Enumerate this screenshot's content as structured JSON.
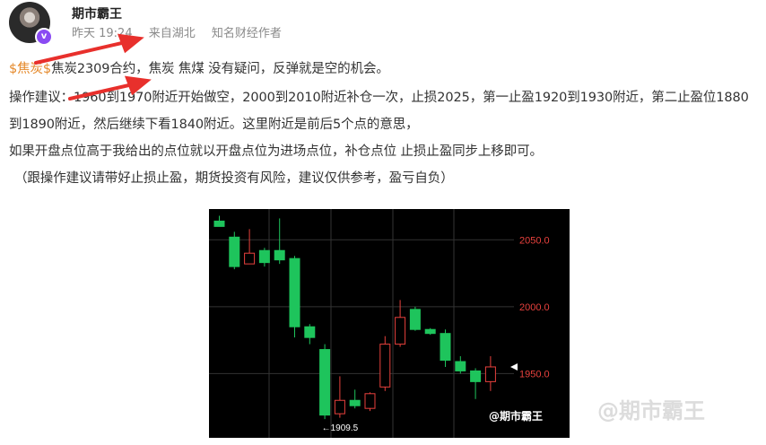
{
  "post": {
    "username": "期市霸王",
    "time": "昨天 19:24",
    "location": "来自湖北",
    "badge": "知名财经作者",
    "stock_tag": "$焦炭$",
    "line1_rest": "焦炭2309合约，焦炭 焦煤 没有疑问，反弹就是空的机会。",
    "line2": "操作建议：1960到1970附近开始做空，2000到2010附近补仓一次，止损2025，第一止盈1920到1930附近，第二止盈位1880",
    "line3": "到1890附近，然后继续下看1840附近。这里附近是前后5个点的意思，",
    "line4": "如果开盘点位高于我给出的点位就以开盘点位为进场点位，补仓点位 止损止盈同步上移即可。",
    "line5": "（跟操作建议请带好止损止盈，期货投资有风险，建议仅供参考，盈亏自负）",
    "watermark": "@期市霸王"
  },
  "chart_data": {
    "type": "candlestick",
    "price_labels": [
      "2050.0",
      "2000.0",
      "1950.0"
    ],
    "low_label": "←1909.5",
    "watermark": "@期市霸王",
    "ylim": [
      1902,
      2073
    ],
    "candles": [
      {
        "o": 2064,
        "c": 2060,
        "h": 2068,
        "l": 2060
      },
      {
        "o": 2052,
        "c": 2030,
        "h": 2056,
        "l": 2028
      },
      {
        "o": 2032,
        "c": 2040,
        "h": 2058,
        "l": 2032
      },
      {
        "o": 2042,
        "c": 2033,
        "h": 2044,
        "l": 2030
      },
      {
        "o": 2042,
        "c": 2035,
        "h": 2066,
        "l": 2032
      },
      {
        "o": 2036,
        "c": 1985,
        "h": 2038,
        "l": 1977
      },
      {
        "o": 1985,
        "c": 1977,
        "h": 1987,
        "l": 1972
      },
      {
        "o": 1968,
        "c": 1919,
        "h": 1972,
        "l": 1916
      },
      {
        "o": 1920,
        "c": 1930,
        "h": 1948,
        "l": 1917
      },
      {
        "o": 1930,
        "c": 1926,
        "h": 1938,
        "l": 1924
      },
      {
        "o": 1924,
        "c": 1935,
        "h": 1936,
        "l": 1922
      },
      {
        "o": 1940,
        "c": 1972,
        "h": 1978,
        "l": 1937
      },
      {
        "o": 1972,
        "c": 1992,
        "h": 2005,
        "l": 1970
      },
      {
        "o": 1998,
        "c": 1983,
        "h": 2000,
        "l": 1982
      },
      {
        "o": 1983,
        "c": 1980,
        "h": 1984,
        "l": 1979
      },
      {
        "o": 1980,
        "c": 1960,
        "h": 1983,
        "l": 1955
      },
      {
        "o": 1959,
        "c": 1952,
        "h": 1963,
        "l": 1950
      },
      {
        "o": 1952,
        "c": 1944,
        "h": 1954,
        "l": 1931
      },
      {
        "o": 1944,
        "c": 1955,
        "h": 1963,
        "l": 1937
      }
    ],
    "last_price": 1955,
    "colors": {
      "up": "#e8413d",
      "down": "#1ec45c",
      "background": "#000000",
      "price_text": "#e8413d"
    }
  }
}
